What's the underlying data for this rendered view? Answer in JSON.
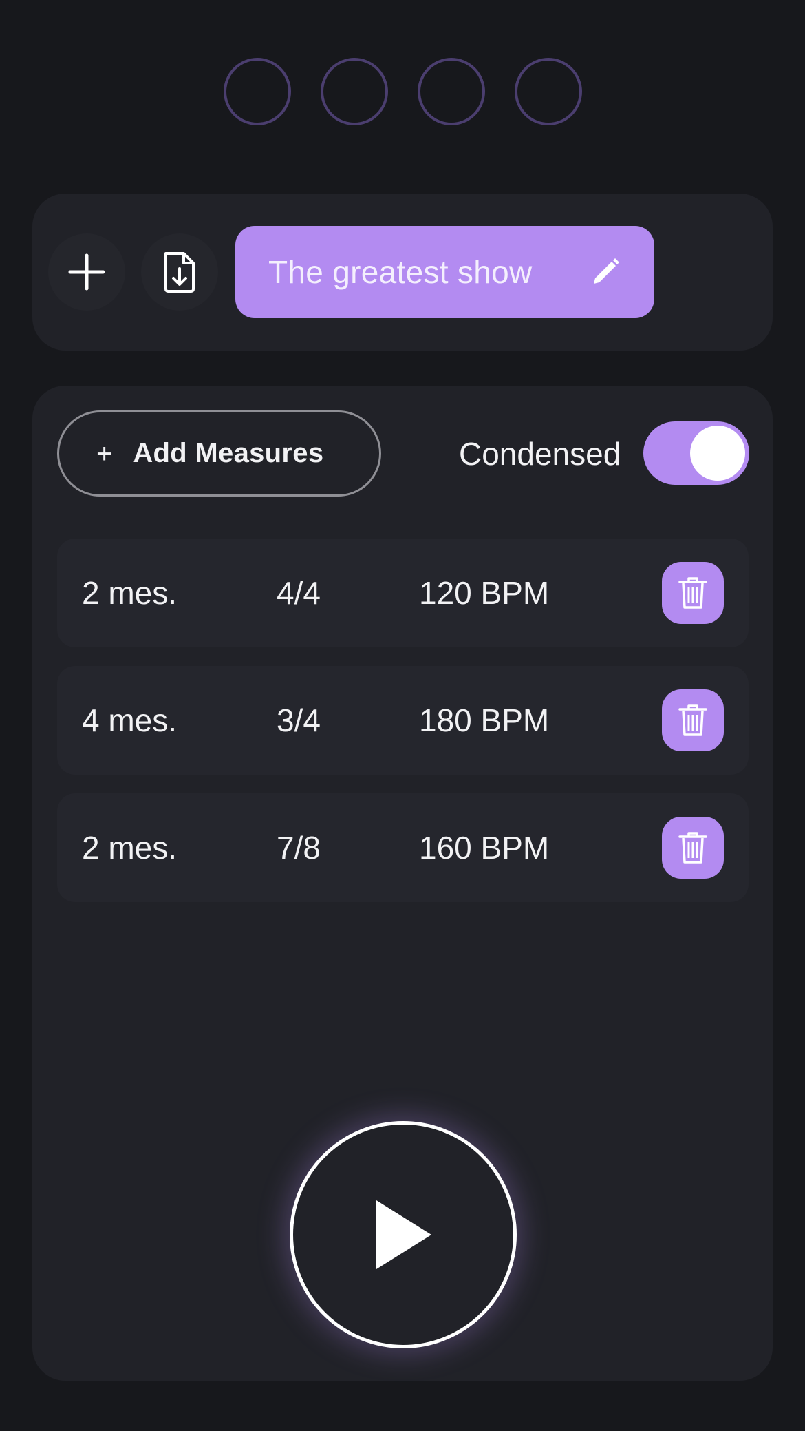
{
  "beats": [
    {
      "icon": "beat-indicator"
    },
    {
      "icon": "beat-indicator"
    },
    {
      "icon": "beat-indicator"
    },
    {
      "icon": "beat-indicator"
    }
  ],
  "toolbar": {
    "add_icon": "plus-icon",
    "import_icon": "file-download-icon",
    "song_title": "The greatest show",
    "edit_icon": "pencil-icon"
  },
  "controls": {
    "add_measures_label": "Add Measures",
    "add_measures_icon": "+",
    "condensed_label": "Condensed",
    "condensed_on": true
  },
  "measures": [
    {
      "count": "2 mes.",
      "signature": "4/4",
      "tempo": "120 BPM"
    },
    {
      "count": "4 mes.",
      "signature": "3/4",
      "tempo": "180 BPM"
    },
    {
      "count": "2 mes.",
      "signature": "7/8",
      "tempo": "160 BPM"
    }
  ],
  "colors": {
    "accent": "#b38bf1",
    "background": "#17181c",
    "card": "#212228",
    "beat_ring": "#4b3e6f"
  },
  "player": {
    "play_icon": "play-icon"
  }
}
